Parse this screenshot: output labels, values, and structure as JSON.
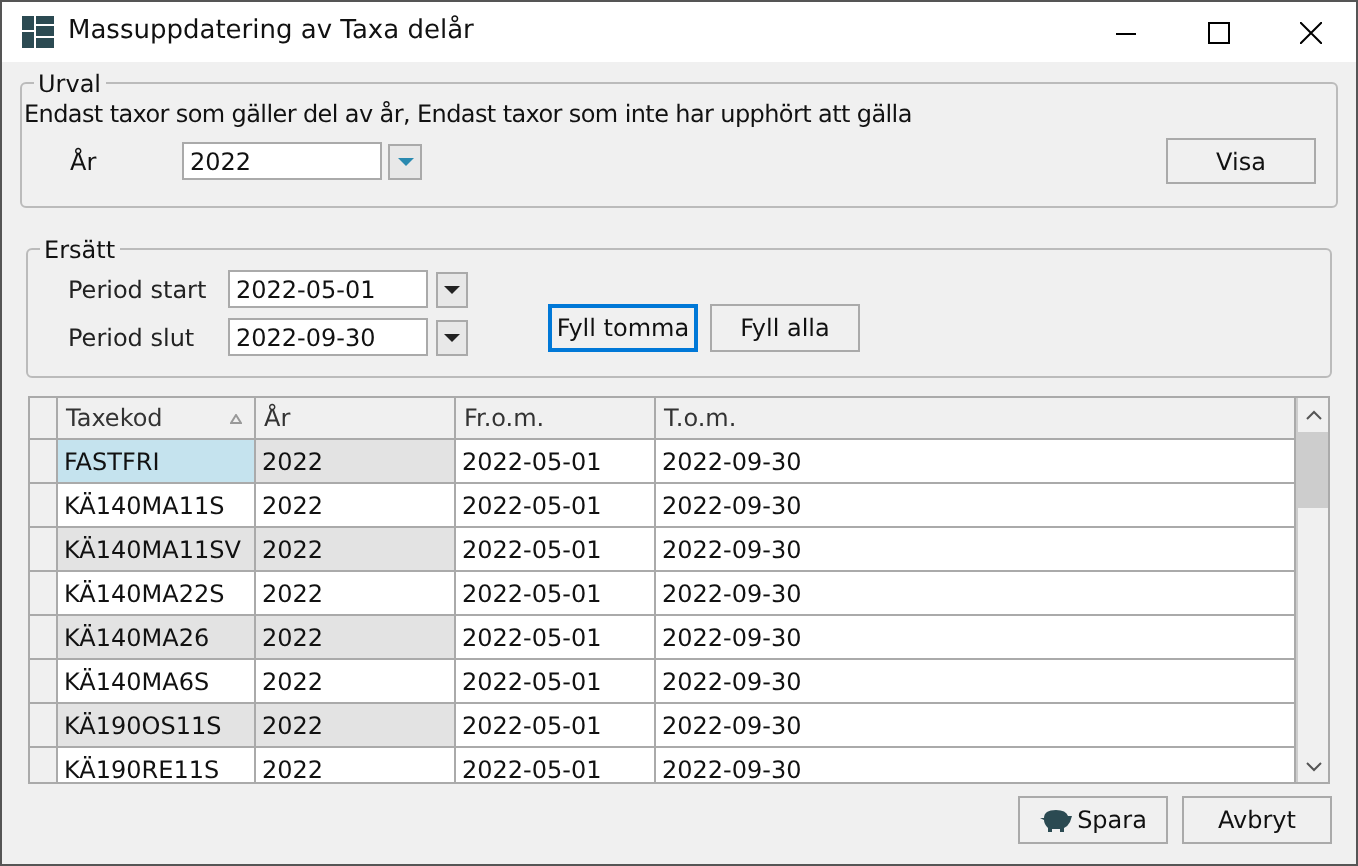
{
  "window": {
    "title": "Massuppdatering av Taxa delår"
  },
  "urval": {
    "legend": "Urval",
    "description": "Endast taxor som gäller del av år, Endast taxor som inte har upphört att gälla",
    "year_label": "År",
    "year_value": "2022",
    "show_button": "Visa"
  },
  "ersatt": {
    "legend": "Ersätt",
    "fields": [
      {
        "label": "Period start",
        "value": "2022-05-01"
      },
      {
        "label": "Period slut",
        "value": "2022-09-30"
      }
    ],
    "buttons": [
      {
        "label": "Fyll tomma",
        "focused": true
      },
      {
        "label": "Fyll alla",
        "focused": false
      }
    ]
  },
  "table": {
    "columns": [
      {
        "label": "Taxekod",
        "sorted": true
      },
      {
        "label": "År",
        "sorted": false
      },
      {
        "label": "Fr.o.m.",
        "sorted": false
      },
      {
        "label": "T.o.m.",
        "sorted": false
      }
    ],
    "rows": [
      {
        "cells": [
          "FASTFRI",
          "2022",
          "2022-05-01",
          "2022-09-30"
        ],
        "selected": true,
        "shaded": true
      },
      {
        "cells": [
          "KÄ140MA11S",
          "2022",
          "2022-05-01",
          "2022-09-30"
        ],
        "selected": false,
        "shaded": false
      },
      {
        "cells": [
          "KÄ140MA11SV",
          "2022",
          "2022-05-01",
          "2022-09-30"
        ],
        "selected": false,
        "shaded": true
      },
      {
        "cells": [
          "KÄ140MA22S",
          "2022",
          "2022-05-01",
          "2022-09-30"
        ],
        "selected": false,
        "shaded": false
      },
      {
        "cells": [
          "KÄ140MA26",
          "2022",
          "2022-05-01",
          "2022-09-30"
        ],
        "selected": false,
        "shaded": true
      },
      {
        "cells": [
          "KÄ140MA6S",
          "2022",
          "2022-05-01",
          "2022-09-30"
        ],
        "selected": false,
        "shaded": false
      },
      {
        "cells": [
          "KÄ190OS11S",
          "2022",
          "2022-05-01",
          "2022-09-30"
        ],
        "selected": false,
        "shaded": true
      },
      {
        "cells": [
          "KÄ190RE11S",
          "2022",
          "2022-05-01",
          "2022-09-30"
        ],
        "selected": false,
        "shaded": false
      }
    ]
  },
  "footer_buttons": [
    {
      "label": "Spara",
      "kind": "save"
    },
    {
      "label": "Avbryt",
      "kind": "plain"
    }
  ]
}
